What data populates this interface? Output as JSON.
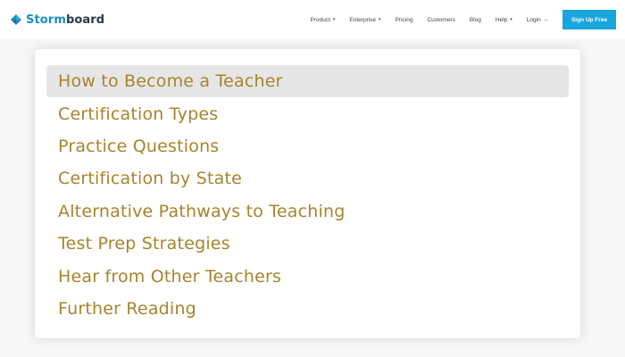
{
  "header": {
    "logo": {
      "text_part1": "Storm",
      "text_part2": "board",
      "icon": "stormboard-logo-icon"
    },
    "nav": [
      {
        "label": "Product",
        "caret": "▾"
      },
      {
        "label": "Enterprise",
        "caret": "▾"
      },
      {
        "label": "Pricing"
      },
      {
        "label": "Customers"
      },
      {
        "label": "Blog"
      },
      {
        "label": "Help",
        "caret": "▾"
      },
      {
        "label": "Login →"
      }
    ],
    "cta_label": "Sign Up Free"
  },
  "menu": {
    "items": [
      {
        "label": "How to Become a Teacher"
      },
      {
        "label": "Certification Types"
      },
      {
        "label": "Practice Questions"
      },
      {
        "label": "Certification by State"
      },
      {
        "label": "Alternative Pathways to Teaching"
      },
      {
        "label": "Test Prep Strategies"
      },
      {
        "label": "Hear from Other Teachers"
      },
      {
        "label": "Further Reading"
      }
    ],
    "active_index": 0
  },
  "colors": {
    "brand_blue": "#1b8fbf",
    "cta_blue": "#1aa6db",
    "menu_text_gold": "#a6842c",
    "active_bg": "#e6e6e6"
  }
}
